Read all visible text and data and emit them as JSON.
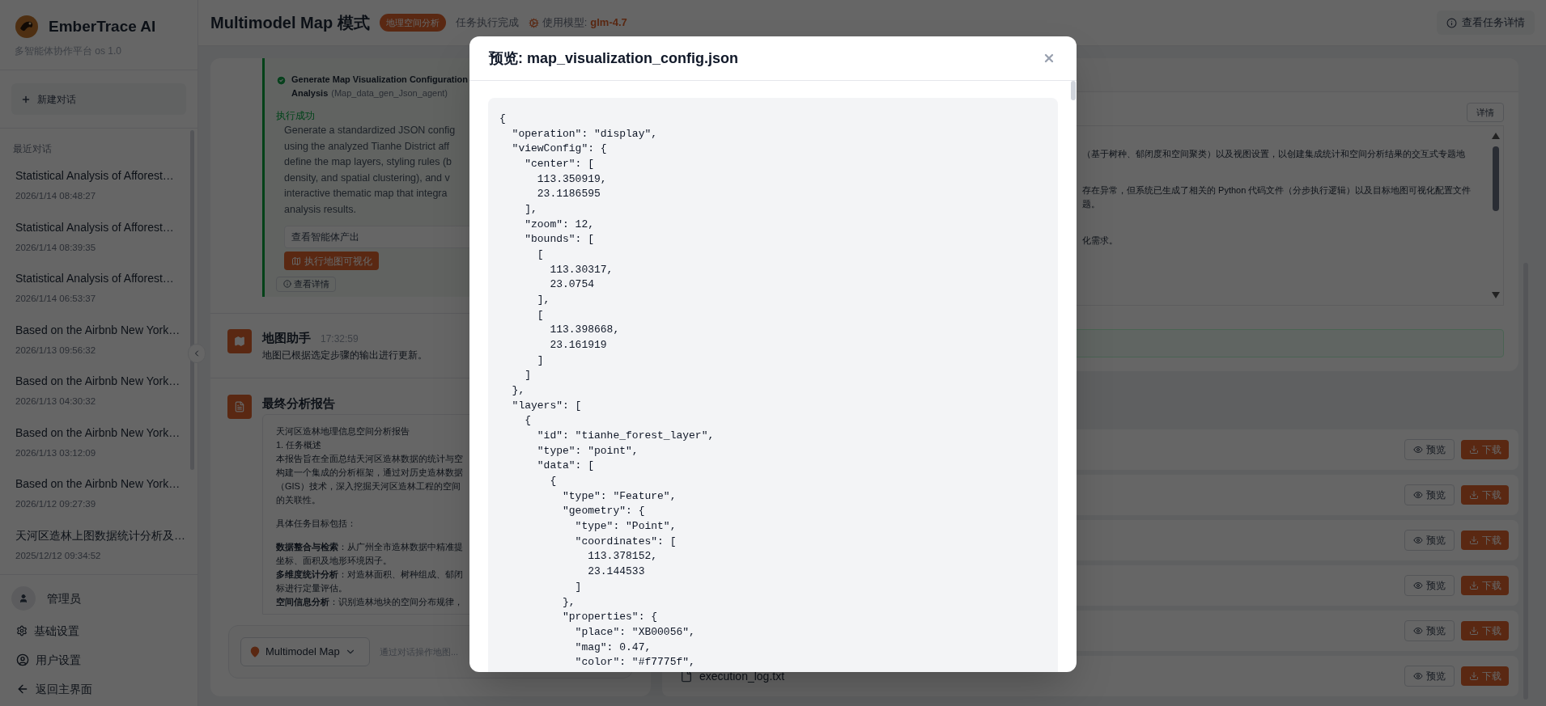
{
  "sidebar": {
    "brand": "EmberTrace AI",
    "subtitle": "多智能体协作平台 os 1.0",
    "new_chat": "新建对话",
    "recent_label": "最近对话",
    "conversations": [
      {
        "title": "Statistical Analysis of Afforest…",
        "time": "2026/1/14 08:48:27"
      },
      {
        "title": "Statistical Analysis of Afforest…",
        "time": "2026/1/14 08:39:35"
      },
      {
        "title": "Statistical Analysis of Afforest…",
        "time": "2026/1/14 06:53:37"
      },
      {
        "title": "Based on the Airbnb New York…",
        "time": "2026/1/13 09:56:32"
      },
      {
        "title": "Based on the Airbnb New York…",
        "time": "2026/1/13 04:30:32"
      },
      {
        "title": "Based on the Airbnb New York…",
        "time": "2026/1/13 03:12:09"
      },
      {
        "title": "Based on the Airbnb New York…",
        "time": "2026/1/12 09:27:39"
      },
      {
        "title": "天河区造林上图数据统计分析及…",
        "time": "2025/12/12 09:34:52"
      }
    ],
    "user": "管理员",
    "links": [
      {
        "kind": "settings",
        "label": "基础设置"
      },
      {
        "kind": "user",
        "label": "用户设置"
      },
      {
        "kind": "back",
        "label": "返回主界面"
      }
    ]
  },
  "header": {
    "title": "Multimodel Map 模式",
    "tag": "地理空间分析",
    "status": "任务执行完成",
    "model_label": "使用模型:",
    "model": "glm-4.7",
    "details_button": "查看任务详情"
  },
  "step": {
    "title": "Generate Map Visualization Configuration",
    "title_line2": "Analysis",
    "agent": "(Map_data_gen_Json_agent)",
    "status": "执行成功",
    "description_lines": [
      "Generate a standardized JSON config",
      "using the analyzed Tianhe District aff",
      "define the map layers, styling rules (b",
      "density, and spatial clustering), and v",
      "interactive thematic map that integra",
      "analysis results."
    ],
    "output_select": "查看智能体产出",
    "run_button": "执行地图可视化",
    "details_button": "查看详情"
  },
  "assistant_message": {
    "name": "地图助手",
    "time": "17:32:59",
    "text": "地图已根据选定步骤的输出进行更新。"
  },
  "report": {
    "title": "最终分析报告",
    "paragraphs": [
      [
        "天河区造林地理信息空间分析报告",
        "1. 任务概述",
        "本报告旨在全面总结天河区造林数据的统计与空",
        "构建一个集成的分析框架，通过对历史造林数据",
        "（GIS）技术，深入挖掘天河区造林工程的空间",
        "的关联性。"
      ],
      [
        "具体任务目标包括："
      ],
      [
        "**数据整合与检索**：从广州全市造林数据中精准提",
        "坐标、面积及地形环境因子。",
        "**多维度统计分析**：对造林面积、树种组成、郁闭",
        "标进行定量评估。",
        "**空间信息分析**：识别造林地块的空间分布规律，"
      ]
    ]
  },
  "map_input": {
    "mode": "Multimodel Map",
    "placeholder": "通过对话操作地图..."
  },
  "summary_panel": {
    "details_button": "详情",
    "paragraphs": [
      [
        "（基于树种、郁闭度和空间聚类）以及视图设置，以创建集成统计和空间分析结果的交互式专题地"
      ],
      [
        "存在异常，但系统已生成了相关的 Python 代码文件（分步执行逻辑）以及目标地图可视化配置文件",
        "题。"
      ],
      [
        "化需求。"
      ]
    ]
  },
  "files": [
    {
      "preview": "预览",
      "download": "下载"
    },
    {
      "preview": "预览",
      "download": "下载"
    },
    {
      "preview": "预览",
      "download": "下载"
    },
    {
      "preview": "预览",
      "download": "下载"
    },
    {
      "preview": "预览",
      "download": "下载"
    },
    {
      "name": "execution_log.txt",
      "preview": "预览",
      "download": "下载"
    }
  ],
  "modal": {
    "title": "预览: map_visualization_config.json",
    "code_lines": [
      "{",
      "  \"operation\": \"display\",",
      "  \"viewConfig\": {",
      "    \"center\": [",
      "      113.350919,",
      "      23.1186595",
      "    ],",
      "    \"zoom\": 12,",
      "    \"bounds\": [",
      "      [",
      "        113.30317,",
      "        23.0754",
      "      ],",
      "      [",
      "        113.398668,",
      "        23.161919",
      "      ]",
      "    ]",
      "  },",
      "  \"layers\": [",
      "    {",
      "      \"id\": \"tianhe_forest_layer\",",
      "      \"type\": \"point\",",
      "      \"data\": [",
      "        {",
      "          \"type\": \"Feature\",",
      "          \"geometry\": {",
      "            \"type\": \"Point\",",
      "            \"coordinates\": [",
      "              113.378152,",
      "              23.144533",
      "            ]",
      "          },",
      "          \"properties\": {",
      "            \"place\": \"XB00056\",",
      "            \"mag\": 0.47,",
      "            \"color\": \"#f7775f\","
    ]
  }
}
